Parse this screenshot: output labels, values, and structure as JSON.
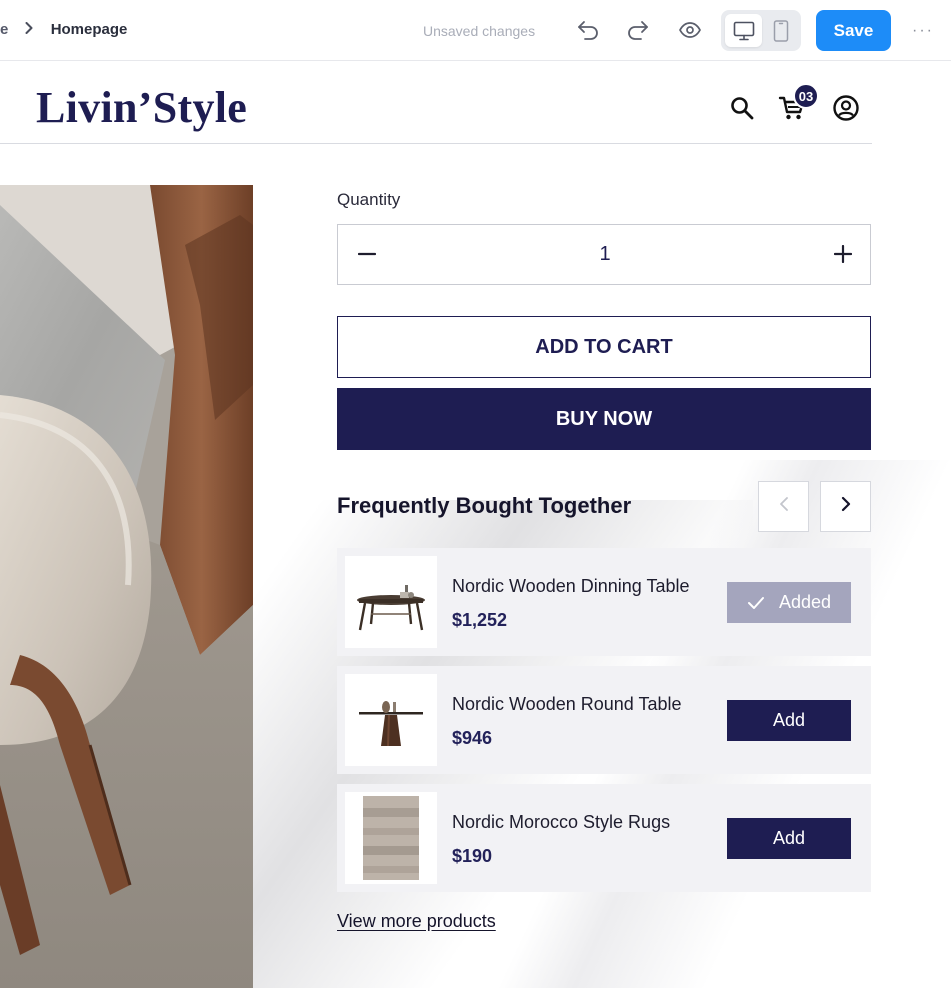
{
  "editor": {
    "breadcrumb_parent": "te",
    "breadcrumb_current": "Homepage",
    "status": "Unsaved changes",
    "save_label": "Save",
    "more_label": "···",
    "accent_color": "#1d8cf8"
  },
  "store": {
    "logo": "Livin’Style",
    "cart_count": "03",
    "brand_color": "#1e1d52"
  },
  "product": {
    "quantity_label": "Quantity",
    "quantity_value": "1",
    "add_to_cart": "ADD TO CART",
    "buy_now": "BUY NOW"
  },
  "fbt": {
    "title": "Frequently Bought Together",
    "items": [
      {
        "name": "Nordic Wooden Dinning Table",
        "price": "$1,252",
        "button": "Added",
        "state": "added",
        "thumb_icon": "dining-table-icon"
      },
      {
        "name": "Nordic Wooden Round Table",
        "price": "$946",
        "button": "Add",
        "state": "add",
        "thumb_icon": "round-table-icon"
      },
      {
        "name": "Nordic Morocco Style Rugs",
        "price": "$190",
        "button": "Add",
        "state": "add",
        "thumb_icon": "rug-icon"
      }
    ],
    "view_more": "View more products"
  },
  "icons": [
    "chevron-right-icon",
    "undo-icon",
    "redo-icon",
    "eye-icon",
    "desktop-icon",
    "mobile-icon",
    "more-icon",
    "search-icon",
    "cart-icon",
    "user-icon",
    "minus-icon",
    "plus-icon",
    "chevron-left-icon",
    "check-icon"
  ]
}
